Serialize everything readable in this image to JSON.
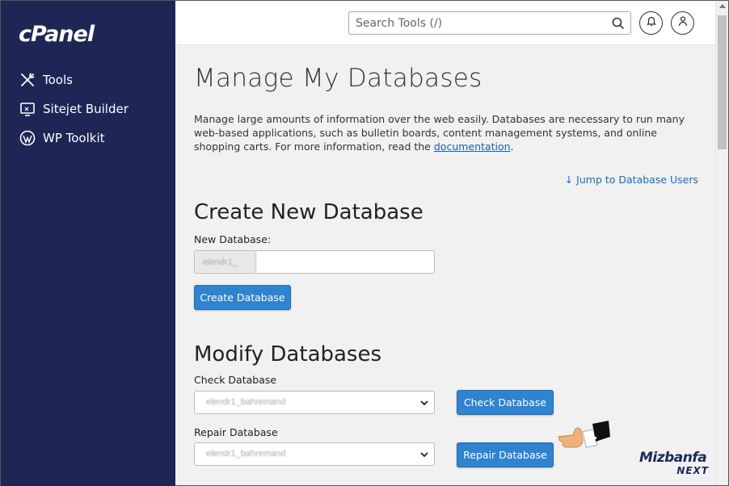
{
  "sidebar": {
    "logo": "cPanel",
    "items": [
      {
        "label": "Tools",
        "icon": "tools-icon"
      },
      {
        "label": "Sitejet Builder",
        "icon": "sitejet-icon"
      },
      {
        "label": "WP Toolkit",
        "icon": "wordpress-icon"
      }
    ]
  },
  "header": {
    "search_placeholder": "Search Tools (/)"
  },
  "main": {
    "title": "Manage My Databases",
    "description_text": "Manage large amounts of information over the web easily. Databases are necessary to run many web-based applications, such as bulletin boards, content management systems, and online shopping carts. For more information, read the ",
    "description_link": "documentation",
    "description_end": ".",
    "jump_link": "Jump to Database Users",
    "create": {
      "heading": "Create New Database",
      "field_label": "New Database:",
      "prefix": "elendr1_",
      "button": "Create Database"
    },
    "modify": {
      "heading": "Modify Databases",
      "check_label": "Check Database",
      "check_selected": "elendr1_bahremand",
      "check_button": "Check Database",
      "repair_label": "Repair Database",
      "repair_selected": "elendr1_bahremand",
      "repair_button": "Repair Database"
    }
  },
  "watermark": {
    "line1": "Mizbanfa",
    "line2": "NEXT"
  },
  "colors": {
    "sidebar": "#1e2656",
    "primary_button": "#2f83cf",
    "link": "#1a6bb8"
  }
}
